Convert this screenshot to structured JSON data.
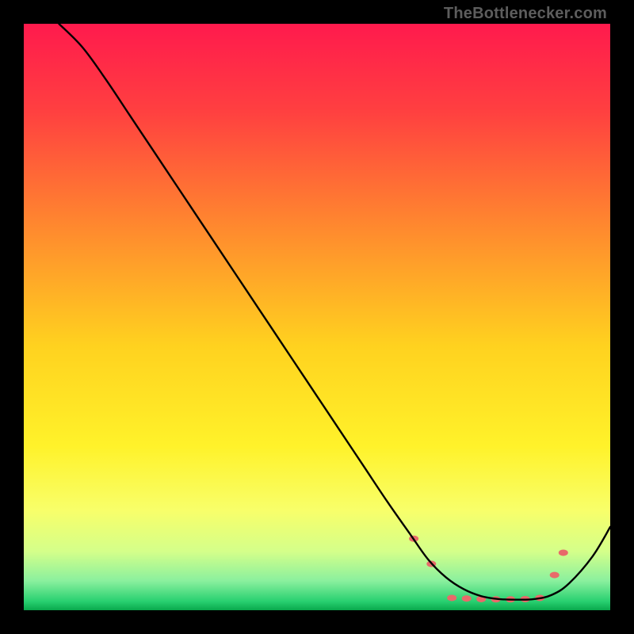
{
  "watermark": "TheBottlenecker.com",
  "chart_data": {
    "type": "line",
    "title": "",
    "xlabel": "",
    "ylabel": "",
    "xlim": [
      0,
      100
    ],
    "ylim": [
      0,
      100
    ],
    "grid": false,
    "background": {
      "type": "vertical-gradient",
      "stops": [
        {
          "pos": 0.0,
          "color": "#ff1a4d"
        },
        {
          "pos": 0.15,
          "color": "#ff4040"
        },
        {
          "pos": 0.35,
          "color": "#ff8a2e"
        },
        {
          "pos": 0.55,
          "color": "#ffd21f"
        },
        {
          "pos": 0.72,
          "color": "#fff22a"
        },
        {
          "pos": 0.83,
          "color": "#f8ff6a"
        },
        {
          "pos": 0.9,
          "color": "#d4ff8a"
        },
        {
          "pos": 0.95,
          "color": "#8af09e"
        },
        {
          "pos": 0.985,
          "color": "#28d070"
        },
        {
          "pos": 1.0,
          "color": "#09a84c"
        }
      ]
    },
    "series": [
      {
        "name": "curve",
        "color": "#000000",
        "x": [
          6,
          10,
          14,
          18,
          22,
          26,
          30,
          34,
          38,
          42,
          46,
          50,
          54,
          58,
          62,
          66,
          69,
          72,
          75,
          78,
          81,
          84,
          87,
          90,
          93,
          97,
          100
        ],
        "y": [
          100,
          96,
          90.5,
          84.5,
          78.5,
          72.5,
          66.5,
          60.5,
          54.5,
          48.5,
          42.5,
          36.5,
          30.5,
          24.5,
          18.5,
          12.8,
          8.6,
          5.6,
          3.6,
          2.4,
          1.9,
          1.8,
          1.9,
          2.6,
          4.6,
          9.2,
          14.2
        ]
      }
    ],
    "markers": {
      "color": "#e86a6a",
      "rx": 6,
      "ry": 4,
      "points": [
        {
          "x": 66.5,
          "y": 12.2
        },
        {
          "x": 69.5,
          "y": 7.9
        },
        {
          "x": 73.0,
          "y": 2.1
        },
        {
          "x": 75.5,
          "y": 2.0
        },
        {
          "x": 78.0,
          "y": 1.9
        },
        {
          "x": 80.5,
          "y": 1.85
        },
        {
          "x": 83.0,
          "y": 1.85
        },
        {
          "x": 85.5,
          "y": 1.9
        },
        {
          "x": 88.0,
          "y": 2.1
        },
        {
          "x": 90.5,
          "y": 6.0
        },
        {
          "x": 92.0,
          "y": 9.8
        }
      ]
    }
  }
}
